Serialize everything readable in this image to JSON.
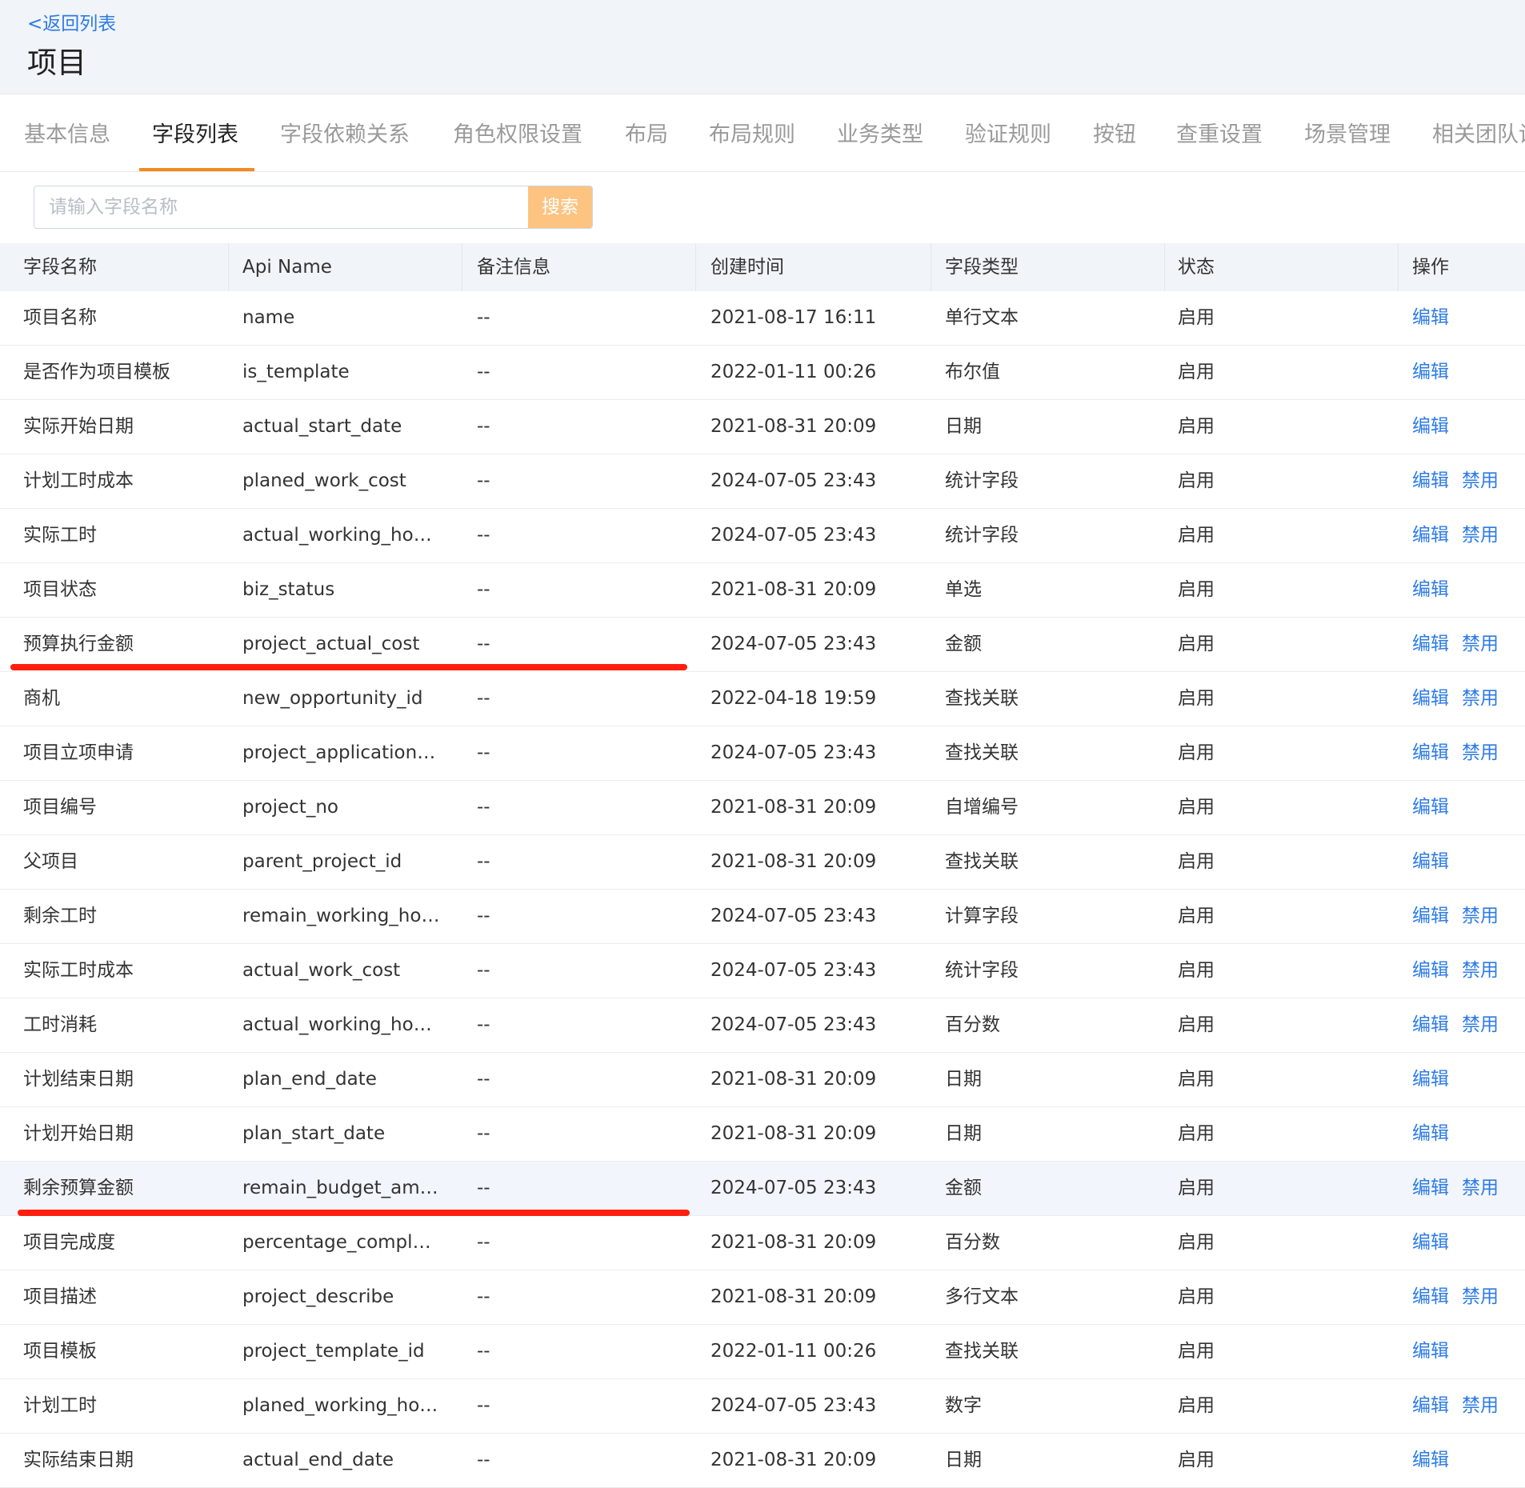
{
  "header": {
    "back_label": "<返回列表",
    "title": "项目"
  },
  "tabs": [
    {
      "label": "基本信息"
    },
    {
      "label": "字段列表",
      "active": true
    },
    {
      "label": "字段依赖关系"
    },
    {
      "label": "角色权限设置"
    },
    {
      "label": "布局"
    },
    {
      "label": "布局规则"
    },
    {
      "label": "业务类型"
    },
    {
      "label": "验证规则"
    },
    {
      "label": "按钮"
    },
    {
      "label": "查重设置"
    },
    {
      "label": "场景管理"
    },
    {
      "label": "相关团队设"
    }
  ],
  "search": {
    "placeholder": "请输入字段名称",
    "button_label": "搜索"
  },
  "table": {
    "columns": [
      "字段名称",
      "Api Name",
      "备注信息",
      "创建时间",
      "字段类型",
      "状态",
      "操作"
    ],
    "rows": [
      {
        "name": "项目名称",
        "api": "name",
        "note": "--",
        "created": "2021-08-17 16:11",
        "type": "单行文本",
        "status": "启用",
        "ops": [
          "编辑"
        ]
      },
      {
        "name": "是否作为项目模板",
        "api": "is_template",
        "note": "--",
        "created": "2022-01-11 00:26",
        "type": "布尔值",
        "status": "启用",
        "ops": [
          "编辑"
        ]
      },
      {
        "name": "实际开始日期",
        "api": "actual_start_date",
        "note": "--",
        "created": "2021-08-31 20:09",
        "type": "日期",
        "status": "启用",
        "ops": [
          "编辑"
        ]
      },
      {
        "name": "计划工时成本",
        "api": "planed_work_cost",
        "note": "--",
        "created": "2024-07-05 23:43",
        "type": "统计字段",
        "status": "启用",
        "ops": [
          "编辑",
          "禁用"
        ]
      },
      {
        "name": "实际工时",
        "api": "actual_working_hours",
        "note": "--",
        "created": "2024-07-05 23:43",
        "type": "统计字段",
        "status": "启用",
        "ops": [
          "编辑",
          "禁用"
        ]
      },
      {
        "name": "项目状态",
        "api": "biz_status",
        "note": "--",
        "created": "2021-08-31 20:09",
        "type": "单选",
        "status": "启用",
        "ops": [
          "编辑"
        ]
      },
      {
        "name": "预算执行金额",
        "api": "project_actual_cost",
        "note": "--",
        "created": "2024-07-05 23:43",
        "type": "金额",
        "status": "启用",
        "ops": [
          "编辑",
          "禁用"
        ],
        "marked": true
      },
      {
        "name": "商机",
        "api": "new_opportunity_id",
        "note": "--",
        "created": "2022-04-18 19:59",
        "type": "查找关联",
        "status": "启用",
        "ops": [
          "编辑",
          "禁用"
        ]
      },
      {
        "name": "项目立项申请",
        "api": "project_application_id",
        "note": "--",
        "created": "2024-07-05 23:43",
        "type": "查找关联",
        "status": "启用",
        "ops": [
          "编辑",
          "禁用"
        ]
      },
      {
        "name": "项目编号",
        "api": "project_no",
        "note": "--",
        "created": "2021-08-31 20:09",
        "type": "自增编号",
        "status": "启用",
        "ops": [
          "编辑"
        ]
      },
      {
        "name": "父项目",
        "api": "parent_project_id",
        "note": "--",
        "created": "2021-08-31 20:09",
        "type": "查找关联",
        "status": "启用",
        "ops": [
          "编辑"
        ]
      },
      {
        "name": "剩余工时",
        "api": "remain_working_hours",
        "note": "--",
        "created": "2024-07-05 23:43",
        "type": "计算字段",
        "status": "启用",
        "ops": [
          "编辑",
          "禁用"
        ]
      },
      {
        "name": "实际工时成本",
        "api": "actual_work_cost",
        "note": "--",
        "created": "2024-07-05 23:43",
        "type": "统计字段",
        "status": "启用",
        "ops": [
          "编辑",
          "禁用"
        ]
      },
      {
        "name": "工时消耗",
        "api": "actual_working_hour…",
        "note": "--",
        "created": "2024-07-05 23:43",
        "type": "百分数",
        "status": "启用",
        "ops": [
          "编辑",
          "禁用"
        ]
      },
      {
        "name": "计划结束日期",
        "api": "plan_end_date",
        "note": "--",
        "created": "2021-08-31 20:09",
        "type": "日期",
        "status": "启用",
        "ops": [
          "编辑"
        ]
      },
      {
        "name": "计划开始日期",
        "api": "plan_start_date",
        "note": "--",
        "created": "2021-08-31 20:09",
        "type": "日期",
        "status": "启用",
        "ops": [
          "编辑"
        ]
      },
      {
        "name": "剩余预算金额",
        "api": "remain_budget_amount",
        "note": "--",
        "created": "2024-07-05 23:43",
        "type": "金额",
        "status": "启用",
        "ops": [
          "编辑",
          "禁用"
        ],
        "marked": true,
        "hover": true
      },
      {
        "name": "项目完成度",
        "api": "percentage_complete",
        "note": "--",
        "created": "2021-08-31 20:09",
        "type": "百分数",
        "status": "启用",
        "ops": [
          "编辑"
        ]
      },
      {
        "name": "项目描述",
        "api": "project_describe",
        "note": "--",
        "created": "2021-08-31 20:09",
        "type": "多行文本",
        "status": "启用",
        "ops": [
          "编辑",
          "禁用"
        ]
      },
      {
        "name": "项目模板",
        "api": "project_template_id",
        "note": "--",
        "created": "2022-01-11 00:26",
        "type": "查找关联",
        "status": "启用",
        "ops": [
          "编辑"
        ]
      },
      {
        "name": "计划工时",
        "api": "planed_working_hours",
        "note": "--",
        "created": "2024-07-05 23:43",
        "type": "数字",
        "status": "启用",
        "ops": [
          "编辑",
          "禁用"
        ]
      },
      {
        "name": "实际结束日期",
        "api": "actual_end_date",
        "note": "--",
        "created": "2021-08-31 20:09",
        "type": "日期",
        "status": "启用",
        "ops": [
          "编辑"
        ]
      }
    ]
  },
  "colors": {
    "accent": "#f5891f",
    "link": "#2d7be5",
    "search_button": "#fcc381",
    "annotation_mark": "#ff1f0f",
    "header_bg": "#f1f4f8"
  }
}
